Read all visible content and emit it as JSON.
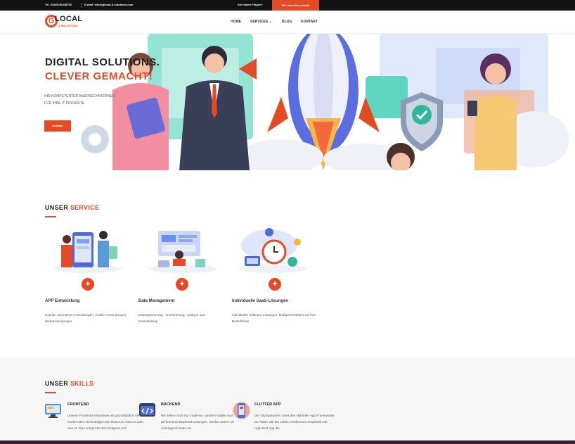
{
  "topbar": {
    "phone": "Tel. 04155-90428760",
    "email": "E-mail: info@glocal-it-solutions.com",
    "question": "Sie haben Fragen?",
    "cta": "Wir rufen Sie zurück!"
  },
  "logo": {
    "letter": "G",
    "name": "LOCAL",
    "sub": "IT SOLUTIONS"
  },
  "nav": {
    "home": "HOME",
    "services": "SERVICES",
    "blog": "BLOG",
    "kontakt": "KONTAKT"
  },
  "hero": {
    "title_line1": "DIGITAL SOLUTIONS.",
    "title_line2": "CLEVER GEMACHT!",
    "subtitle_line1": "IHR KOMPETENTER ANSPRECHPARTNER",
    "subtitle_line2": "FÜR IHRE IT PROJEKTE",
    "button": "Kontakt"
  },
  "services": {
    "title_part1": "UNSER ",
    "title_part2": "SERVICE",
    "items": [
      {
        "title": "APP Entwicklung",
        "text": "Hybride und native Anwendungen, mobile Anwendungen, Webanwendungen"
      },
      {
        "title": "Data Management",
        "text": "Datengewinnung, -anreicherung, -analyse und -bereitstellung"
      },
      {
        "title": "Individuelle SaaS-Lösungen",
        "text": "Individuelle Software-Lösungen. Maßgeschneidert auf Ihre Bedürfnisse."
      }
    ]
  },
  "skills": {
    "title_part1": "UNSER ",
    "title_part2": "SKILLS",
    "items": [
      {
        "title": "FRONTEND",
        "text": "Unsere Frontends entwickeln wir grundsätzlich mit den modernsten Technologien wie React.Js, Next.Js oder Vue.Js. Das entspricht dem Zeitgeist und"
      },
      {
        "title": "BACKEND",
        "text": "Wir liefern nicht nur moderne, sondern stabile und performante Backend-Lösungen. Hierfür nutzen wir vorwiegend Node.JS."
      },
      {
        "title": "FLUTTER APP",
        "text": "Der Olympstürmer unter den Hybriden App Frameworks ist Flutter. Mit der Clean Architecture entwickeln wir High-End App die"
      }
    ]
  },
  "colors": {
    "accent": "#e34a26",
    "topbar": "#121212",
    "skills_bg": "#f6f6f6"
  }
}
